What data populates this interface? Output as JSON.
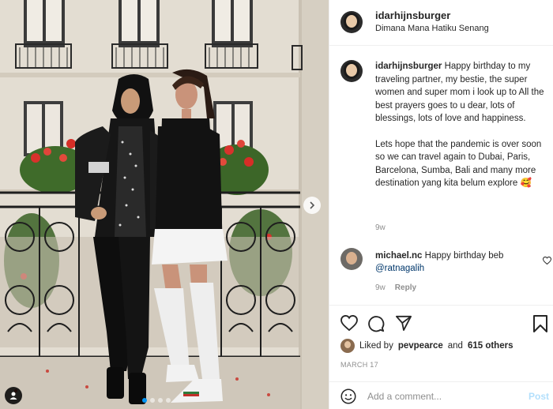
{
  "post": {
    "username": "idarhijnsburger",
    "location": "Dimana Mana Hatiku Senang"
  },
  "caption": {
    "username": "idarhijnsburger",
    "text1": "Happy birthday to my traveling partner, my bestie, the super women and super mom i look up to All the best prayers goes to u dear, lots of blessings, lots of love and happiness.",
    "text2": "Lets hope that the pandemic is over soon so we can travel again to Dubai, Paris, Barcelona, Sumba, Bali and many more destination yang kita belum explore 🥰",
    "time": "9w"
  },
  "comment": {
    "username": "michael.nc",
    "text": "Happy birthday beb",
    "mention": "@ratnagalih",
    "time": "9w",
    "reply_label": "Reply"
  },
  "likes": {
    "prefix": "Liked by",
    "user": "pevpearce",
    "connector": "and",
    "others": "615 others"
  },
  "date": "MARCH 17",
  "add_comment": {
    "placeholder": "Add a comment...",
    "post_label": "Post"
  },
  "carousel": {
    "count": 4,
    "active": 0
  },
  "icons": {
    "heart": "heart-icon",
    "comment": "comment-icon",
    "share": "share-icon",
    "save": "bookmark-icon",
    "emoji": "smiley-icon",
    "next": "chevron-right-icon",
    "tag": "user-tag-icon"
  },
  "colors": {
    "link": "#00376b",
    "post_disabled": "#b2dffc",
    "muted": "#8e8e8e",
    "active_dot": "#0095f6"
  }
}
